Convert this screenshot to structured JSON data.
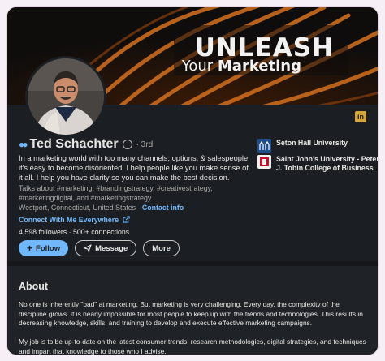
{
  "banner": {
    "title": "UNLEASH",
    "subtitle_prefix": "Your ",
    "subtitle_bold": "Marketing"
  },
  "profile": {
    "name": "Ted Schachter",
    "degree": "· 3rd",
    "headline": "In a marketing world with too many channels, options, & salespeople it's easy to become disoriented. I help people like you make sense of it all. I help you have clarity so you can make the best decision.",
    "talks_about": "Talks about #marketing, #brandingstrategy, #creativestrategy, #marketingdigital, and #marketingstrategy",
    "location": "Westport, Connecticut, United States",
    "location_sep": " · ",
    "contact_info": "Contact info",
    "connect_link": "Connect With Me Everywhere",
    "followers": "4,598 followers",
    "stats_sep": " · ",
    "connections": "500+ connections"
  },
  "actions": {
    "follow": "Follow",
    "follow_icon": "+",
    "message": "Message",
    "more": "More"
  },
  "education": [
    {
      "name": "Seton Hall University",
      "color": "#1f4e8c"
    },
    {
      "name": "Saint John's University - Peter J. Tobin College of Business",
      "color": "#c8102e"
    }
  ],
  "about": {
    "heading": "About",
    "p1": "No one is inherently \"bad\" at marketing. But marketing is very challenging. Every day, the complexity of the discipline grows. It is nearly impossible for most people to keep up with the trends and technologies. This results in decreasing knowledge, skills, and training to develop and execute effective marketing campaigns.",
    "p2": "My job is to be up-to-date on the latest consumer trends, research methodologies, digital strategies, and techniques and impart that knowledge to those who I advise."
  },
  "colors": {
    "accent": "#71b7fb",
    "background": "#1b1f23",
    "banner_arc": "#c96b1e",
    "linkedin_icon": "#d7a63c"
  },
  "icons": {
    "linkedin": "linkedin-icon",
    "verified": "verified-shield-icon",
    "external_link": "external-link-icon",
    "send": "paper-plane-icon"
  }
}
